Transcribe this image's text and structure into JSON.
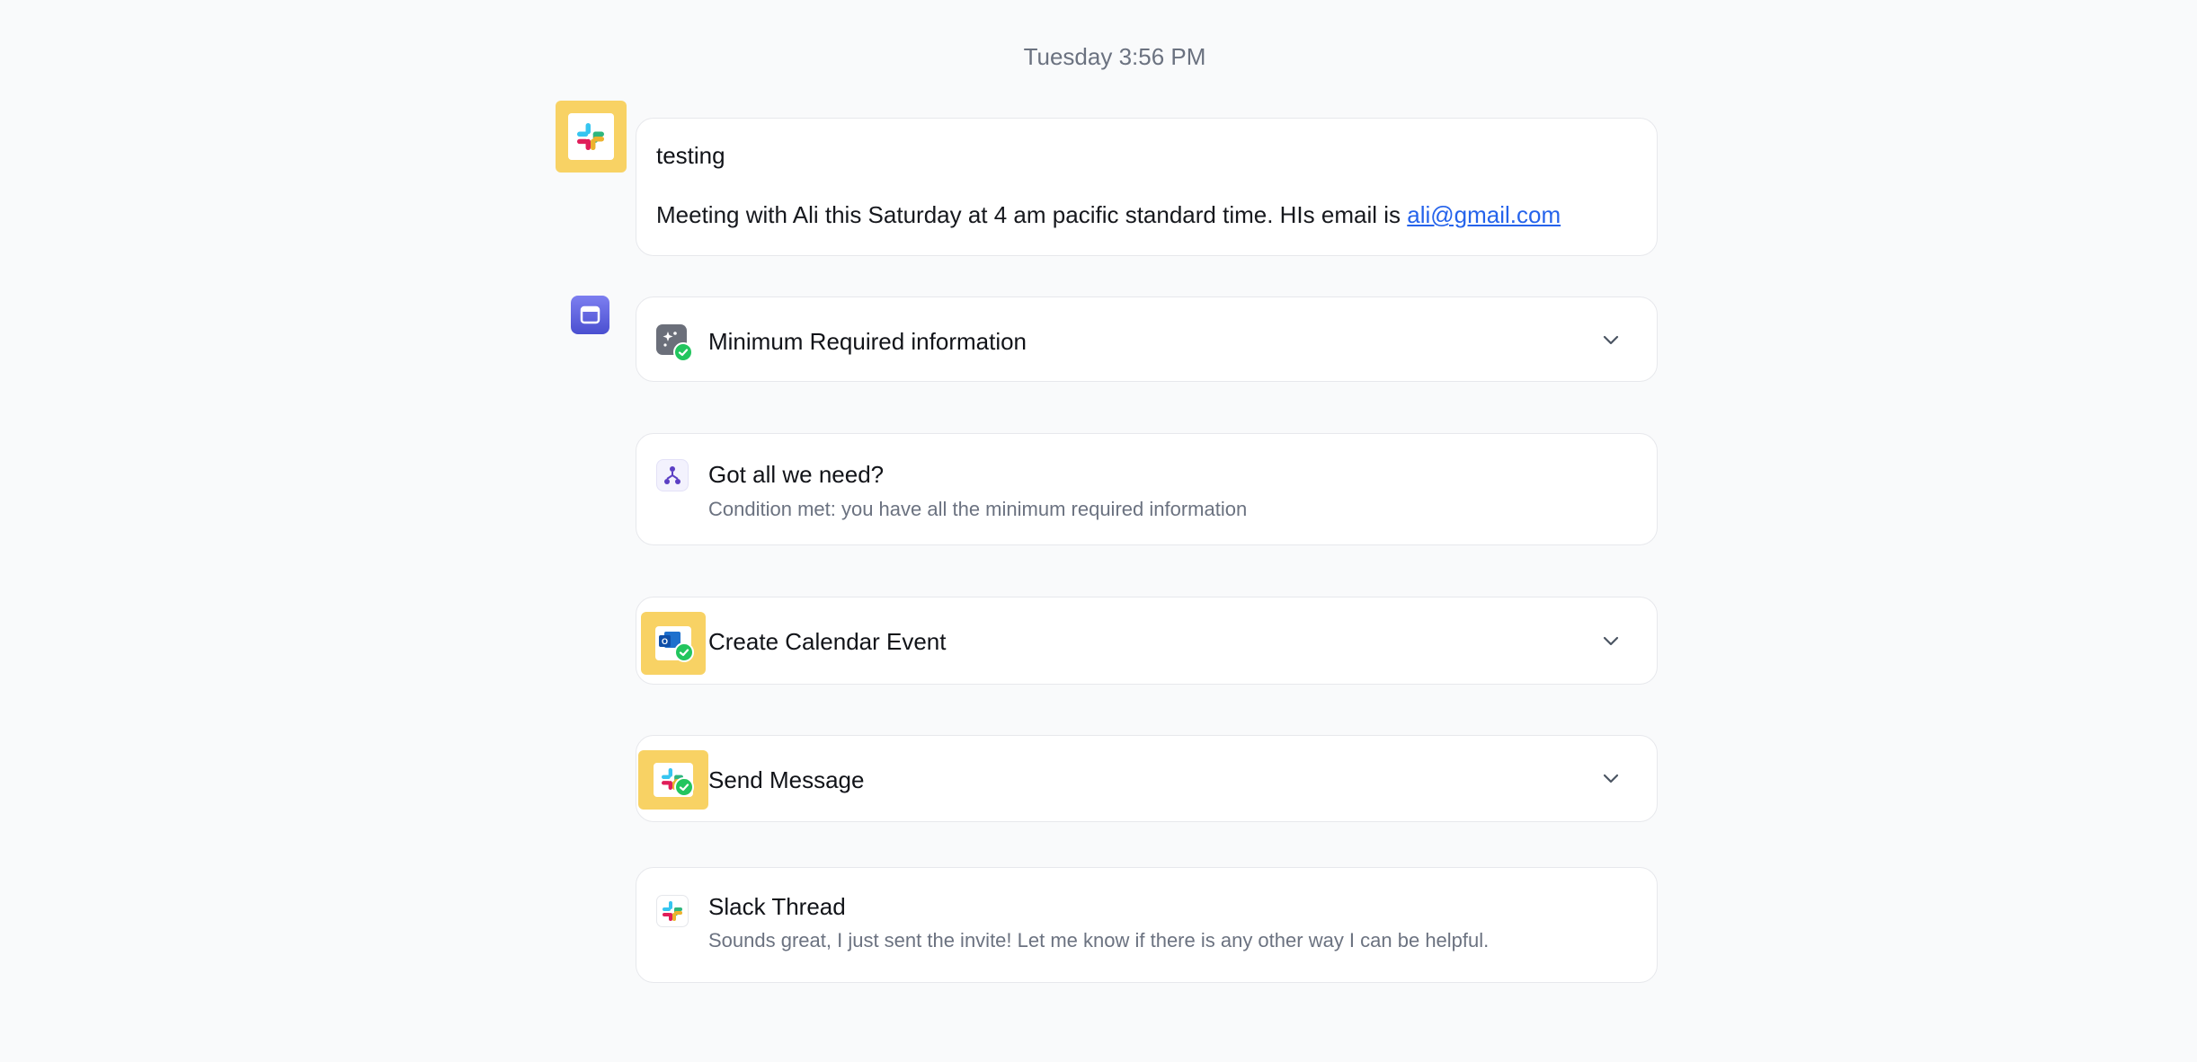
{
  "header": {
    "timestamp": "Tuesday 3:56 PM"
  },
  "message": {
    "source_icon": "slack-icon",
    "title": "testing",
    "body_prefix": "Meeting with Ali this Saturday at 4 am pacific standard time. HIs email is ",
    "email_link": "ali@gmail.com"
  },
  "workflow": {
    "source_icon": "calendar-icon",
    "steps": [
      {
        "title": "Minimum Required information",
        "icon": "ai-extract-icon",
        "status": "completed",
        "expandable": true
      },
      {
        "title": "Got all we need?",
        "subtitle": "Condition met: you have all the minimum required information",
        "icon": "branch-icon"
      },
      {
        "title": "Create Calendar Event",
        "icon": "outlook-calendar-icon",
        "status": "completed",
        "expandable": true
      },
      {
        "title": "Send Message",
        "icon": "slack-icon",
        "status": "completed",
        "expandable": true
      },
      {
        "title": "Slack Thread",
        "subtitle": "Sounds great, I just sent the invite! Let me know if there is any other way I can be helpful.",
        "icon": "slack-icon"
      }
    ]
  },
  "colors": {
    "background": "#f9fafb",
    "card_border": "#e7e8ec",
    "highlight_yellow": "#f8d264",
    "link_blue": "#2563eb",
    "success_green": "#22c55e",
    "calendar_purple": "#5a5de0"
  }
}
